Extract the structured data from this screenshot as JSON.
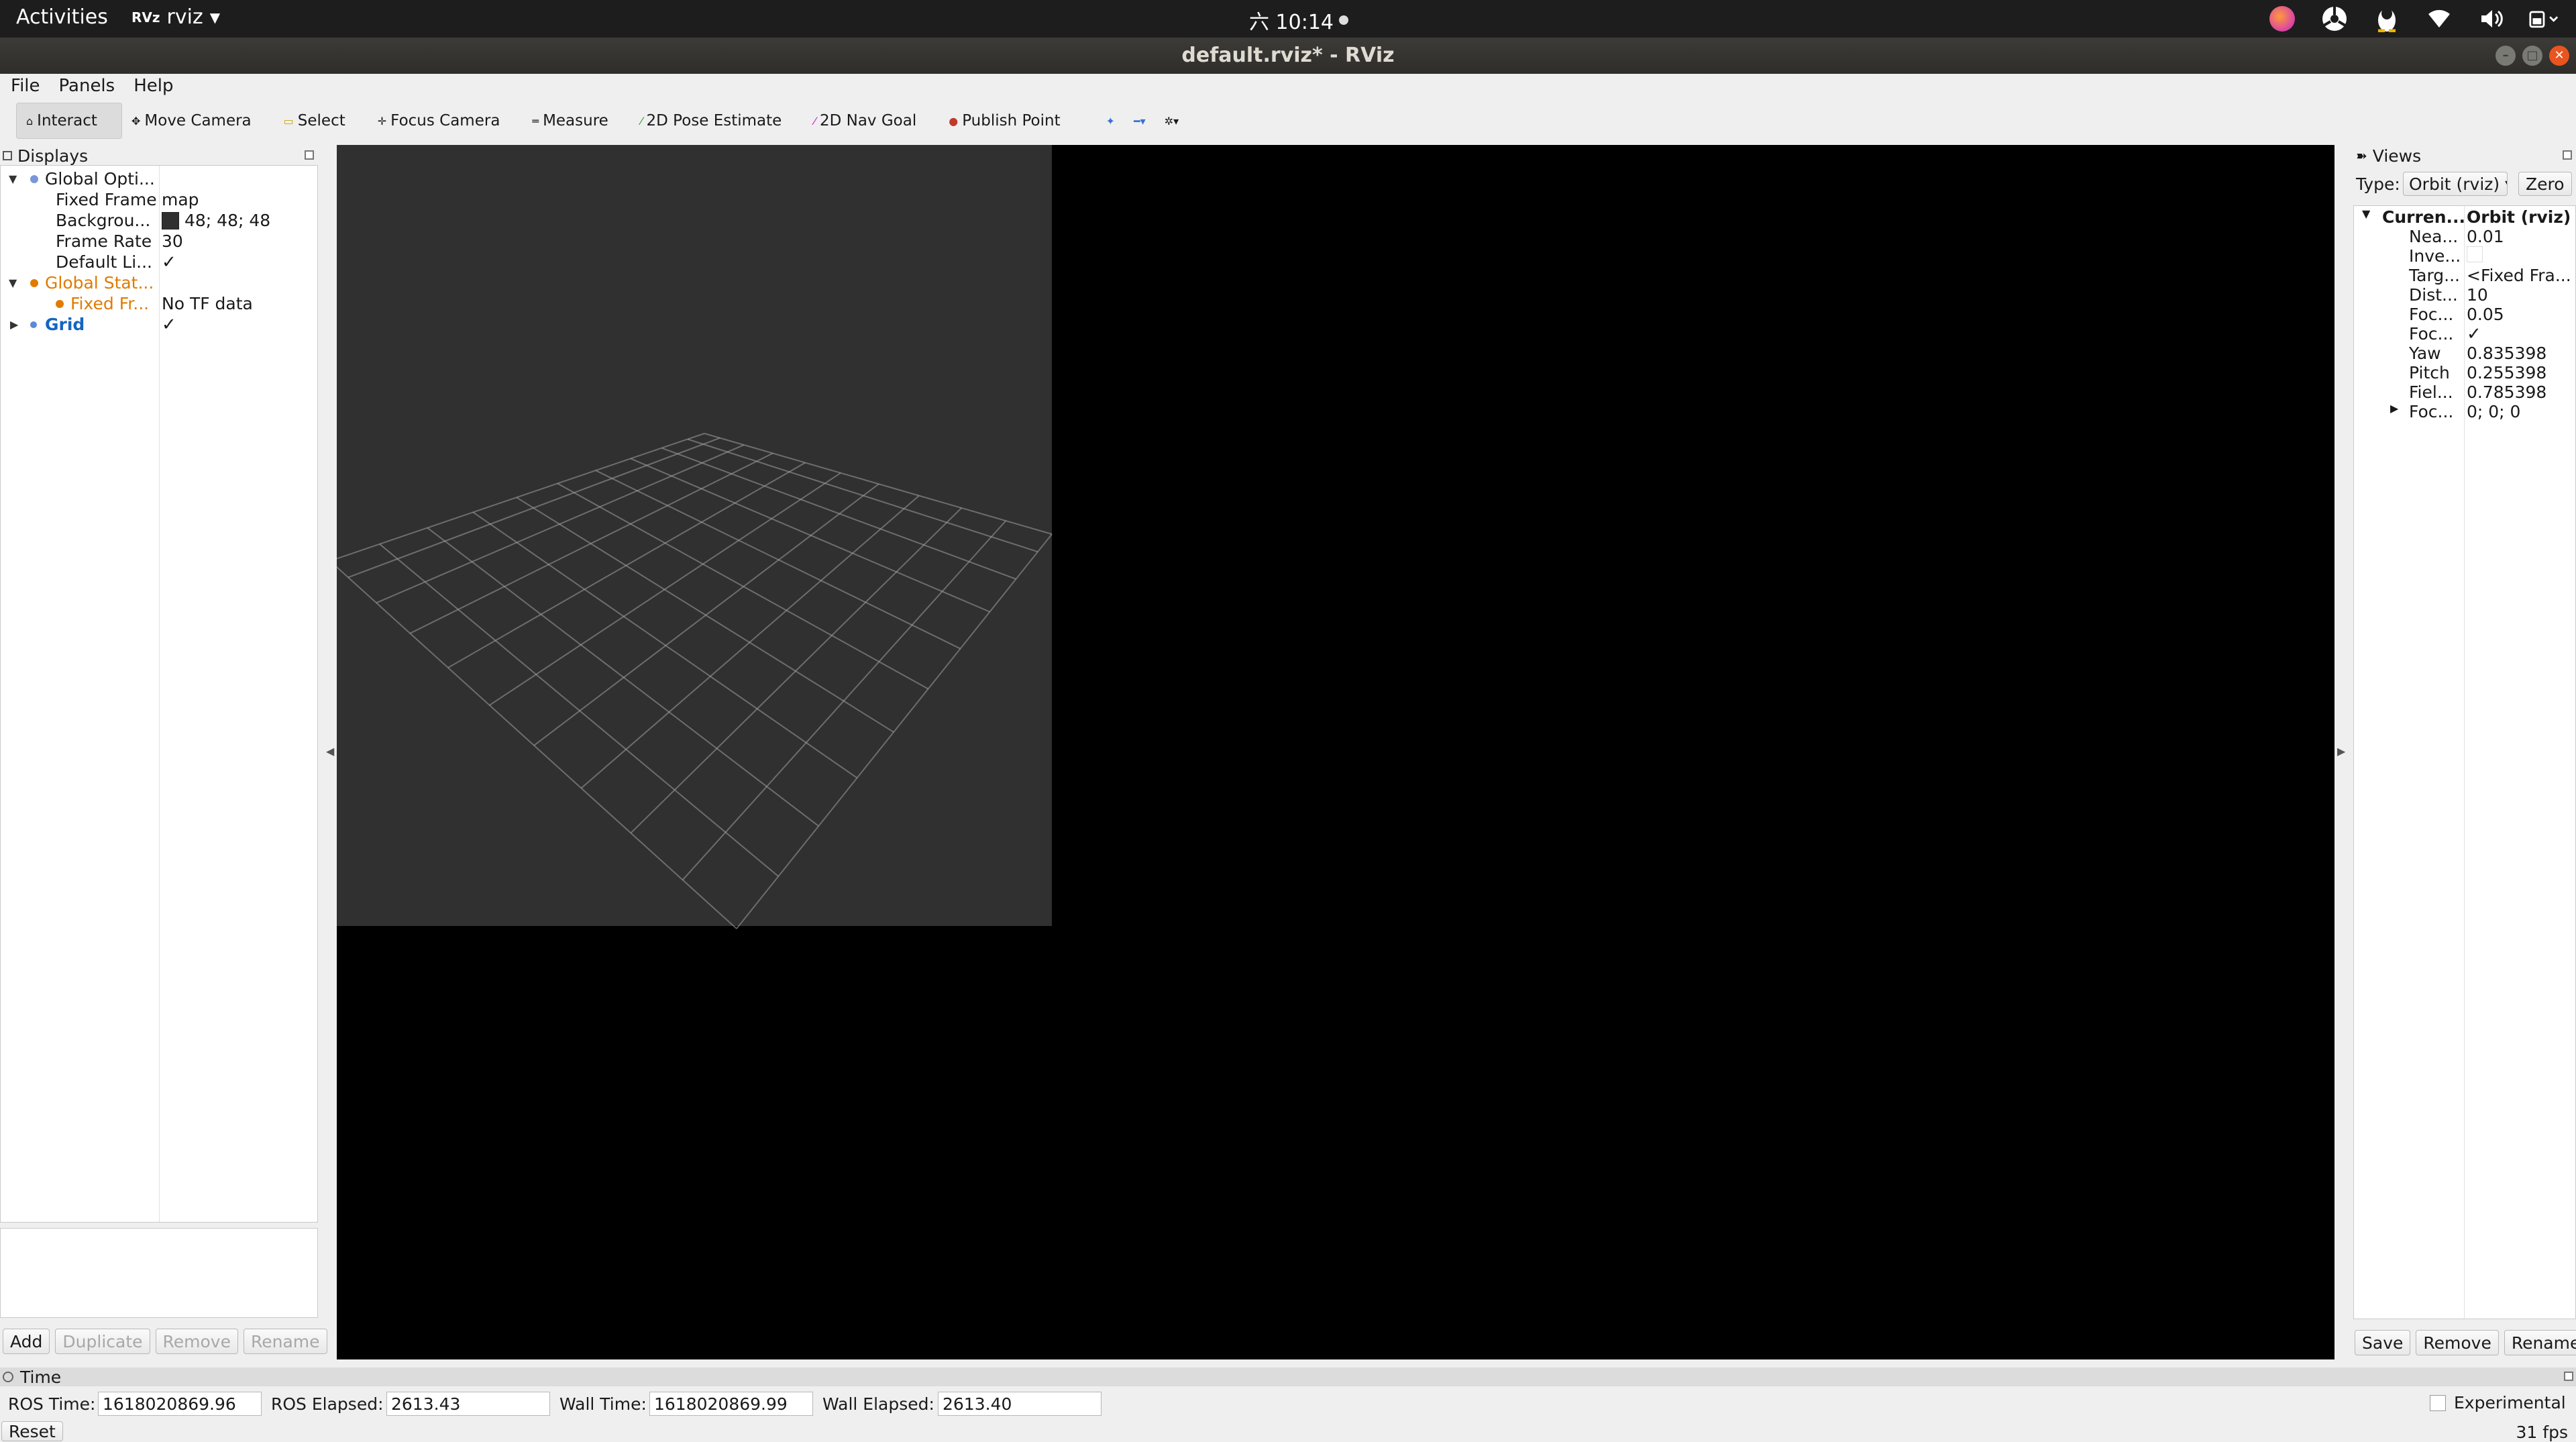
{
  "topbar": {
    "activities": "Activities",
    "app_glyph": "RVz",
    "app_name": "rviz",
    "clock": "六 10:14",
    "tray_icons": [
      "firefox-like-app-icon",
      "hub-icon",
      "penguin-icon",
      "wifi-icon",
      "volume-icon",
      "battery-icon"
    ]
  },
  "window": {
    "title": "default.rviz* - RViz"
  },
  "menu": {
    "file": "File",
    "panels": "Panels",
    "help": "Help"
  },
  "toolbar": {
    "interact": "Interact",
    "move_camera": "Move Camera",
    "select": "Select",
    "focus_camera": "Focus Camera",
    "measure": "Measure",
    "pose_estimate": "2D Pose Estimate",
    "nav_goal": "2D Nav Goal",
    "publish_point": "Publish Point"
  },
  "displays": {
    "title": "Displays",
    "rows": [
      {
        "name": "Global Opti...",
        "value": ""
      },
      {
        "name": "Fixed Frame",
        "value": "map"
      },
      {
        "name": "Backgrou...",
        "value": "48; 48; 48"
      },
      {
        "name": "Frame Rate",
        "value": "30"
      },
      {
        "name": "Default Li...",
        "value": "✓"
      },
      {
        "name": "Global Stat...",
        "value": ""
      },
      {
        "name": "Fixed Fr...",
        "value": "No TF data"
      },
      {
        "name": "Grid",
        "value": "✓"
      }
    ],
    "buttons": {
      "add": "Add",
      "duplicate": "Duplicate",
      "remove": "Remove",
      "rename": "Rename"
    }
  },
  "views": {
    "title": "Views",
    "type_label": "Type:",
    "type_value": "Orbit (rviz)",
    "zero": "Zero",
    "rows": [
      {
        "name": "Curren...",
        "value": "Orbit (rviz)"
      },
      {
        "name": "Nea...",
        "value": "0.01"
      },
      {
        "name": "Inve...",
        "value": ""
      },
      {
        "name": "Targ...",
        "value": "<Fixed Fra..."
      },
      {
        "name": "Dist...",
        "value": "10"
      },
      {
        "name": "Foc...",
        "value": "0.05"
      },
      {
        "name": "Foc...",
        "value": "✓"
      },
      {
        "name": "Yaw",
        "value": "0.835398"
      },
      {
        "name": "Pitch",
        "value": "0.255398"
      },
      {
        "name": "Fiel...",
        "value": "0.785398"
      },
      {
        "name": "Foc...",
        "value": "0; 0; 0"
      }
    ],
    "buttons": {
      "save": "Save",
      "remove": "Remove",
      "rename": "Rename"
    }
  },
  "time": {
    "title": "Time",
    "ros_time_label": "ROS Time:",
    "ros_time": "1618020869.96",
    "ros_elapsed_label": "ROS Elapsed:",
    "ros_elapsed": "2613.43",
    "wall_time_label": "Wall Time:",
    "wall_time": "1618020869.99",
    "wall_elapsed_label": "Wall Elapsed:",
    "wall_elapsed": "2613.40",
    "experimental": "Experimental",
    "reset": "Reset",
    "fps": "31 fps"
  },
  "colors": {
    "render_background": "#303030",
    "grid_line": "#a0a0a0",
    "warning_orange": "#e07b00",
    "grid_blue": "#1565c0"
  }
}
